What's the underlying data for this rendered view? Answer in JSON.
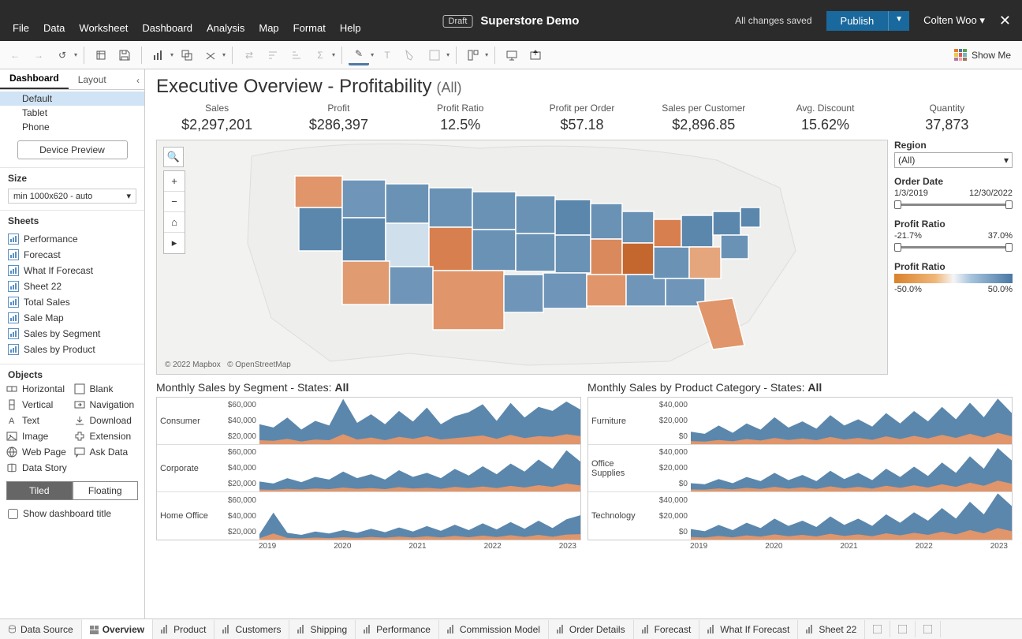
{
  "titlebar": {
    "menus": [
      "File",
      "Data",
      "Worksheet",
      "Dashboard",
      "Analysis",
      "Map",
      "Format",
      "Help"
    ],
    "draft": "Draft",
    "doc": "Superstore Demo",
    "saved": "All changes saved",
    "publish": "Publish",
    "user": "Colten Woo"
  },
  "toolbar": {
    "showme": "Show Me"
  },
  "left": {
    "tabs": {
      "dashboard": "Dashboard",
      "layout": "Layout"
    },
    "devices": [
      "Default",
      "Tablet",
      "Phone"
    ],
    "preview": "Device Preview",
    "size_h": "Size",
    "size_v": "min 1000x620 - auto",
    "sheets_h": "Sheets",
    "sheets": [
      "Performance",
      "Forecast",
      "What If Forecast",
      "Sheet 22",
      "Total Sales",
      "Sale Map",
      "Sales by Segment",
      "Sales by Product"
    ],
    "objects_h": "Objects",
    "objects": [
      "Horizontal",
      "Blank",
      "Vertical",
      "Navigation",
      "Text",
      "Download",
      "Image",
      "Extension",
      "Web Page",
      "Ask Data",
      "Data Story"
    ],
    "tiled": "Tiled",
    "floating": "Floating",
    "showtitle": "Show dashboard title"
  },
  "dash": {
    "title": "Executive Overview - Profitability",
    "title_all": "(All)",
    "kpis": [
      {
        "l": "Sales",
        "v": "$2,297,201"
      },
      {
        "l": "Profit",
        "v": "$286,397"
      },
      {
        "l": "Profit Ratio",
        "v": "12.5%"
      },
      {
        "l": "Profit per Order",
        "v": "$57.18"
      },
      {
        "l": "Sales per Customer",
        "v": "$2,896.85"
      },
      {
        "l": "Avg. Discount",
        "v": "15.62%"
      },
      {
        "l": "Quantity",
        "v": "37,873"
      }
    ],
    "map_attr1": "© 2022 Mapbox",
    "map_attr2": "© OpenStreetMap",
    "filters": {
      "region_h": "Region",
      "region_v": "(All)",
      "date_h": "Order Date",
      "date_from": "1/3/2019",
      "date_to": "12/30/2022",
      "pr_h": "Profit Ratio",
      "pr_from": "-21.7%",
      "pr_to": "37.0%",
      "legend_h": "Profit Ratio",
      "legend_from": "-50.0%",
      "legend_to": "50.0%"
    },
    "seg_title": "Monthly Sales by Segment - States: ",
    "seg_all": "All",
    "cat_title": "Monthly Sales by Product Category - States: ",
    "cat_all": "All",
    "seg_rows": [
      "Consumer",
      "Corporate",
      "Home Office"
    ],
    "cat_rows": [
      "Furniture",
      "Office Supplies",
      "Technology"
    ],
    "seg_ax": [
      "$60,000",
      "$40,000",
      "$20,000"
    ],
    "cat_ax": [
      "$40,000",
      "$20,000",
      "$0"
    ],
    "years": [
      "2019",
      "2020",
      "2021",
      "2022",
      "2023"
    ]
  },
  "tabs": [
    "Data Source",
    "Overview",
    "Product",
    "Customers",
    "Shipping",
    "Performance",
    "Commission Model",
    "Order Details",
    "Forecast",
    "What If Forecast",
    "Sheet 22"
  ],
  "chart_data": {
    "filters": {
      "order_date": {
        "min": "1/3/2019",
        "max": "12/30/2022"
      },
      "profit_ratio": {
        "min": -21.7,
        "max": 37.0,
        "legend_min": -50.0,
        "legend_max": 50.0
      }
    },
    "kpis": {
      "Sales": 2297201,
      "Profit": 286397,
      "Profit Ratio": 0.125,
      "Profit per Order": 57.18,
      "Sales per Customer": 2896.85,
      "Avg. Discount": 0.1562,
      "Quantity": 37873
    },
    "segment": {
      "type": "area",
      "title": "Monthly Sales by Segment - States: All",
      "xlabel": "Year",
      "ylabel": "Sales",
      "ylim": [
        0,
        70000
      ],
      "x_years": [
        2019,
        2020,
        2021,
        2022,
        2023
      ],
      "rows": [
        {
          "name": "Consumer",
          "yticks": [
            20000,
            40000,
            60000
          ],
          "series": [
            {
              "name": "Upper",
              "values": [
                30000,
                25000,
                40000,
                22000,
                35000,
                28000,
                68000,
                32000,
                45000,
                30000,
                50000,
                34000,
                55000,
                30000,
                42000,
                48000,
                60000,
                35000,
                62000,
                40000,
                56000,
                50000,
                64000,
                52000
              ]
            },
            {
              "name": "Lower",
              "values": [
                6000,
                5000,
                8000,
                4000,
                7000,
                6000,
                15000,
                7000,
                10000,
                6000,
                11000,
                8000,
                12000,
                7000,
                9000,
                11000,
                13000,
                8000,
                14000,
                9000,
                12000,
                11000,
                15000,
                12000
              ]
            }
          ]
        },
        {
          "name": "Corporate",
          "yticks": [
            20000,
            40000,
            60000
          ],
          "series": [
            {
              "name": "Upper",
              "values": [
                15000,
                12000,
                20000,
                14000,
                22000,
                18000,
                30000,
                20000,
                26000,
                18000,
                32000,
                22000,
                28000,
                20000,
                34000,
                24000,
                38000,
                26000,
                42000,
                30000,
                48000,
                34000,
                62000,
                45000
              ]
            },
            {
              "name": "Lower",
              "values": [
                3000,
                2500,
                4000,
                3000,
                4500,
                3500,
                6000,
                4000,
                5000,
                3500,
                6500,
                4500,
                5500,
                4000,
                7000,
                5000,
                7500,
                5000,
                8500,
                6000,
                9500,
                7000,
                12000,
                9000
              ]
            }
          ]
        },
        {
          "name": "Home Office",
          "yticks": [
            20000,
            40000,
            60000
          ],
          "series": [
            {
              "name": "Upper",
              "values": [
                8000,
                40000,
                10000,
                7000,
                12000,
                9000,
                14000,
                10000,
                16000,
                11000,
                18000,
                12000,
                20000,
                13000,
                22000,
                14000,
                24000,
                15000,
                26000,
                16000,
                28000,
                17000,
                30000,
                36000
              ]
            },
            {
              "name": "Lower",
              "values": [
                2000,
                9000,
                2500,
                1800,
                3000,
                2200,
                3500,
                2500,
                4000,
                2800,
                4500,
                3000,
                5000,
                3200,
                5500,
                3500,
                6000,
                3800,
                6500,
                4000,
                7000,
                4200,
                7500,
                8000
              ]
            }
          ]
        }
      ]
    },
    "category": {
      "type": "area",
      "title": "Monthly Sales by Product Category - States: All",
      "xlabel": "Year",
      "ylabel": "Sales",
      "ylim": [
        0,
        45000
      ],
      "x_years": [
        2019,
        2020,
        2021,
        2022,
        2023
      ],
      "rows": [
        {
          "name": "Furniture",
          "yticks": [
            0,
            20000,
            40000
          ],
          "series": [
            {
              "name": "Upper",
              "values": [
                12000,
                10000,
                18000,
                11000,
                20000,
                14000,
                26000,
                16000,
                22000,
                15000,
                28000,
                18000,
                24000,
                17000,
                30000,
                20000,
                32000,
                22000,
                36000,
                24000,
                40000,
                26000,
                44000,
                30000
              ]
            },
            {
              "name": "Lower",
              "values": [
                3000,
                2500,
                4000,
                2800,
                5000,
                3500,
                6000,
                4000,
                5500,
                3800,
                7000,
                4500,
                6000,
                4200,
                7500,
                5000,
                8000,
                5500,
                9000,
                6000,
                10000,
                6500,
                11000,
                7500
              ]
            }
          ]
        },
        {
          "name": "Office Supplies",
          "yticks": [
            0,
            20000,
            40000
          ],
          "series": [
            {
              "name": "Upper",
              "values": [
                8000,
                7000,
                12000,
                8000,
                14000,
                10000,
                18000,
                11000,
                16000,
                10000,
                20000,
                12000,
                18000,
                11000,
                22000,
                14000,
                24000,
                15000,
                28000,
                18000,
                34000,
                22000,
                42000,
                30000
              ]
            },
            {
              "name": "Lower",
              "values": [
                2000,
                1800,
                3000,
                2000,
                3500,
                2500,
                4500,
                2800,
                4000,
                2500,
                5000,
                3000,
                4500,
                2800,
                5500,
                3500,
                6000,
                3800,
                7000,
                4500,
                8500,
                5500,
                10500,
                7500
              ]
            }
          ]
        },
        {
          "name": "Technology",
          "yticks": [
            0,
            20000,
            40000
          ],
          "series": [
            {
              "name": "Upper",
              "values": [
                10000,
                8000,
                14000,
                9000,
                16000,
                11000,
                20000,
                13000,
                18000,
                12000,
                22000,
                14000,
                20000,
                13000,
                24000,
                16000,
                26000,
                18000,
                30000,
                20000,
                36000,
                24000,
                44000,
                32000
              ]
            },
            {
              "name": "Lower",
              "values": [
                2500,
                2000,
                3500,
                2200,
                4000,
                2800,
                5000,
                3200,
                4500,
                3000,
                5500,
                3500,
                5000,
                3200,
                6000,
                4000,
                6500,
                4500,
                7500,
                5000,
                9000,
                6000,
                11000,
                8000
              ]
            }
          ]
        }
      ]
    }
  }
}
